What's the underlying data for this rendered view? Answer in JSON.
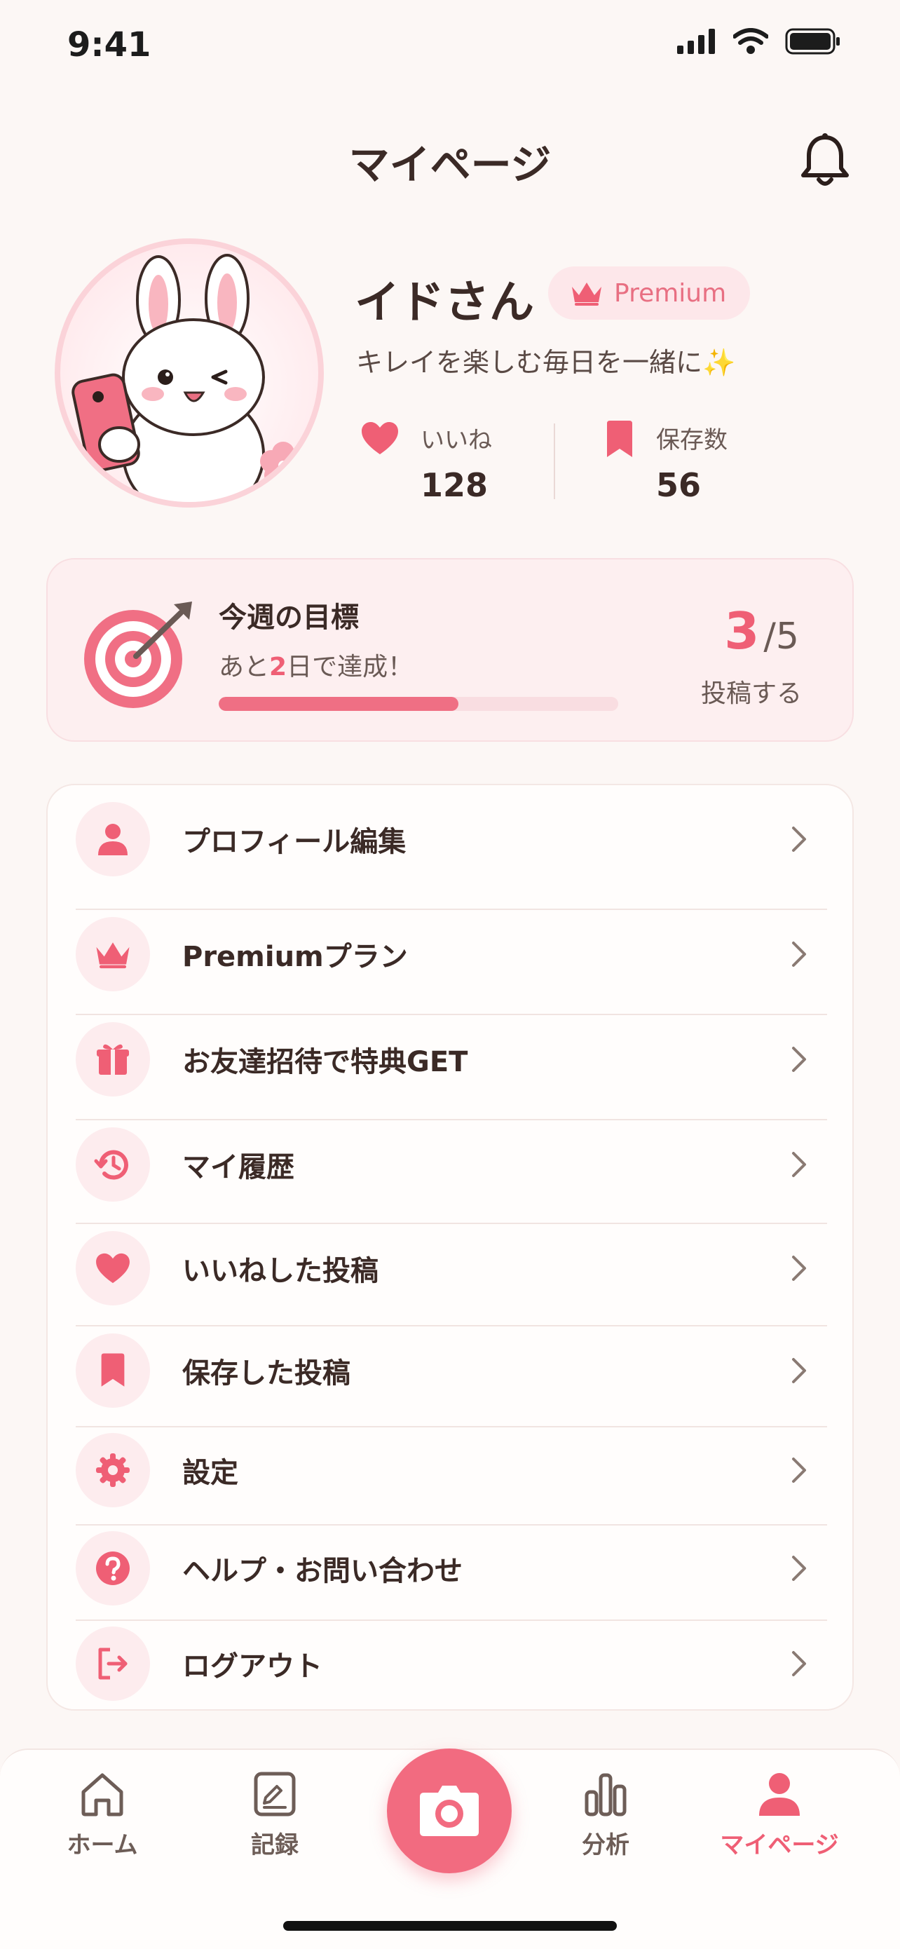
{
  "status": {
    "time": "9:41"
  },
  "header": {
    "title": "マイページ"
  },
  "profile": {
    "name": "イドさん",
    "badge": "Premium",
    "tagline": "キレイを楽しむ毎日を一緒に✨",
    "stats": [
      {
        "label": "いいね",
        "value": "128",
        "icon": "heart-icon"
      },
      {
        "label": "保存数",
        "value": "56",
        "icon": "bookmark-icon"
      }
    ]
  },
  "goal": {
    "title": "今週の目標",
    "sub_prefix": "あと",
    "sub_days": "2",
    "sub_suffix": "日で達成！",
    "current": "3",
    "target": "/5",
    "action": "投稿する",
    "progress": 0.6
  },
  "menu": [
    {
      "label": "プロフィール編集",
      "icon": "person-icon"
    },
    {
      "label": "Premiumプラン",
      "icon": "crown-icon"
    },
    {
      "label": "お友達招待で特典GET",
      "icon": "gift-icon"
    },
    {
      "label": "マイ履歴",
      "icon": "history-icon"
    },
    {
      "label": "いいねした投稿",
      "icon": "heart-icon"
    },
    {
      "label": "保存した投稿",
      "icon": "bookmark-icon"
    },
    {
      "label": "設定",
      "icon": "gear-icon"
    },
    {
      "label": "ヘルプ・お問い合わせ",
      "icon": "help-icon"
    },
    {
      "label": "ログアウト",
      "icon": "logout-icon"
    }
  ],
  "tabs": [
    {
      "label": "ホーム",
      "icon": "home-icon"
    },
    {
      "label": "記録",
      "icon": "notepad-icon"
    },
    {
      "label": "分析",
      "icon": "chart-icon"
    },
    {
      "label": "マイページ",
      "icon": "person-icon",
      "active": true
    }
  ],
  "colors": {
    "accent": "#ef5f75",
    "background": "#fcf7f5",
    "text": "#3b2a26"
  }
}
